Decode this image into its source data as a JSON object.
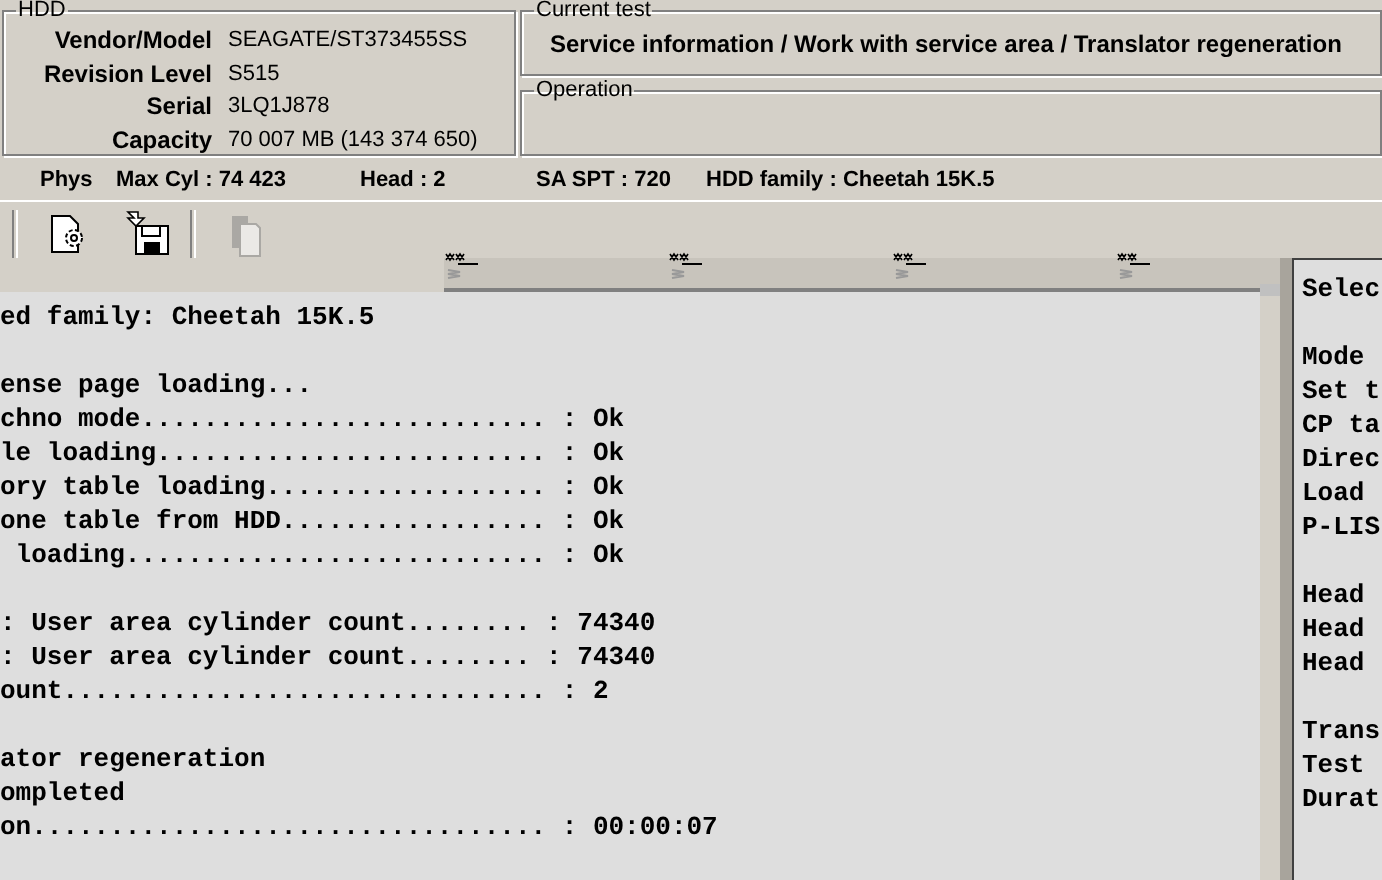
{
  "hdd": {
    "title": "HDD",
    "fields": [
      {
        "label": "Vendor/Model",
        "value": "SEAGATE/ST373455SS"
      },
      {
        "label": "Revision Level",
        "value": "S515"
      },
      {
        "label": "Serial",
        "value": "3LQ1J878"
      },
      {
        "label": "Capacity",
        "value": "70 007 MB (143 374 650)"
      }
    ]
  },
  "current_test": {
    "title": "Current test",
    "text": "Service information / Work with service area / Translator regeneration"
  },
  "operation": {
    "title": "Operation"
  },
  "info_bar": [
    "Phys",
    "Max Cyl : 74 423",
    "Head : 2",
    "SA SPT : 720",
    "HDD family : Cheetah 15K.5"
  ],
  "toolbar": {
    "buttons": [
      {
        "kind": "doc-gear",
        "disabled": false
      },
      {
        "kind": "save",
        "disabled": false
      },
      {
        "kind": "copy",
        "disabled": true
      }
    ]
  },
  "log": {
    "blocks": [
      [
        "ed family: Cheetah 15K.5"
      ],
      [
        "ense page loading...",
        "chno mode.......................... : Ok",
        "le loading......................... : Ok",
        "ory table loading.................. : Ok",
        "one table from HDD................. : Ok",
        " loading........................... : Ok"
      ],
      [
        ": User area cylinder count........ : 74340",
        ": User area cylinder count........ : 74340",
        "ount............................... : 2"
      ],
      [
        "ator regeneration",
        "ompleted",
        "on................................. : 00:00:07"
      ]
    ]
  },
  "side_panel": {
    "blocks": [
      [
        "Selec"
      ],
      [
        "Mode",
        "Set t",
        "CP ta",
        "Direc",
        "Load",
        "P-LIS"
      ],
      [
        "Head",
        "Head",
        "Head"
      ],
      [
        "Trans",
        "Test",
        "Durat"
      ]
    ]
  }
}
